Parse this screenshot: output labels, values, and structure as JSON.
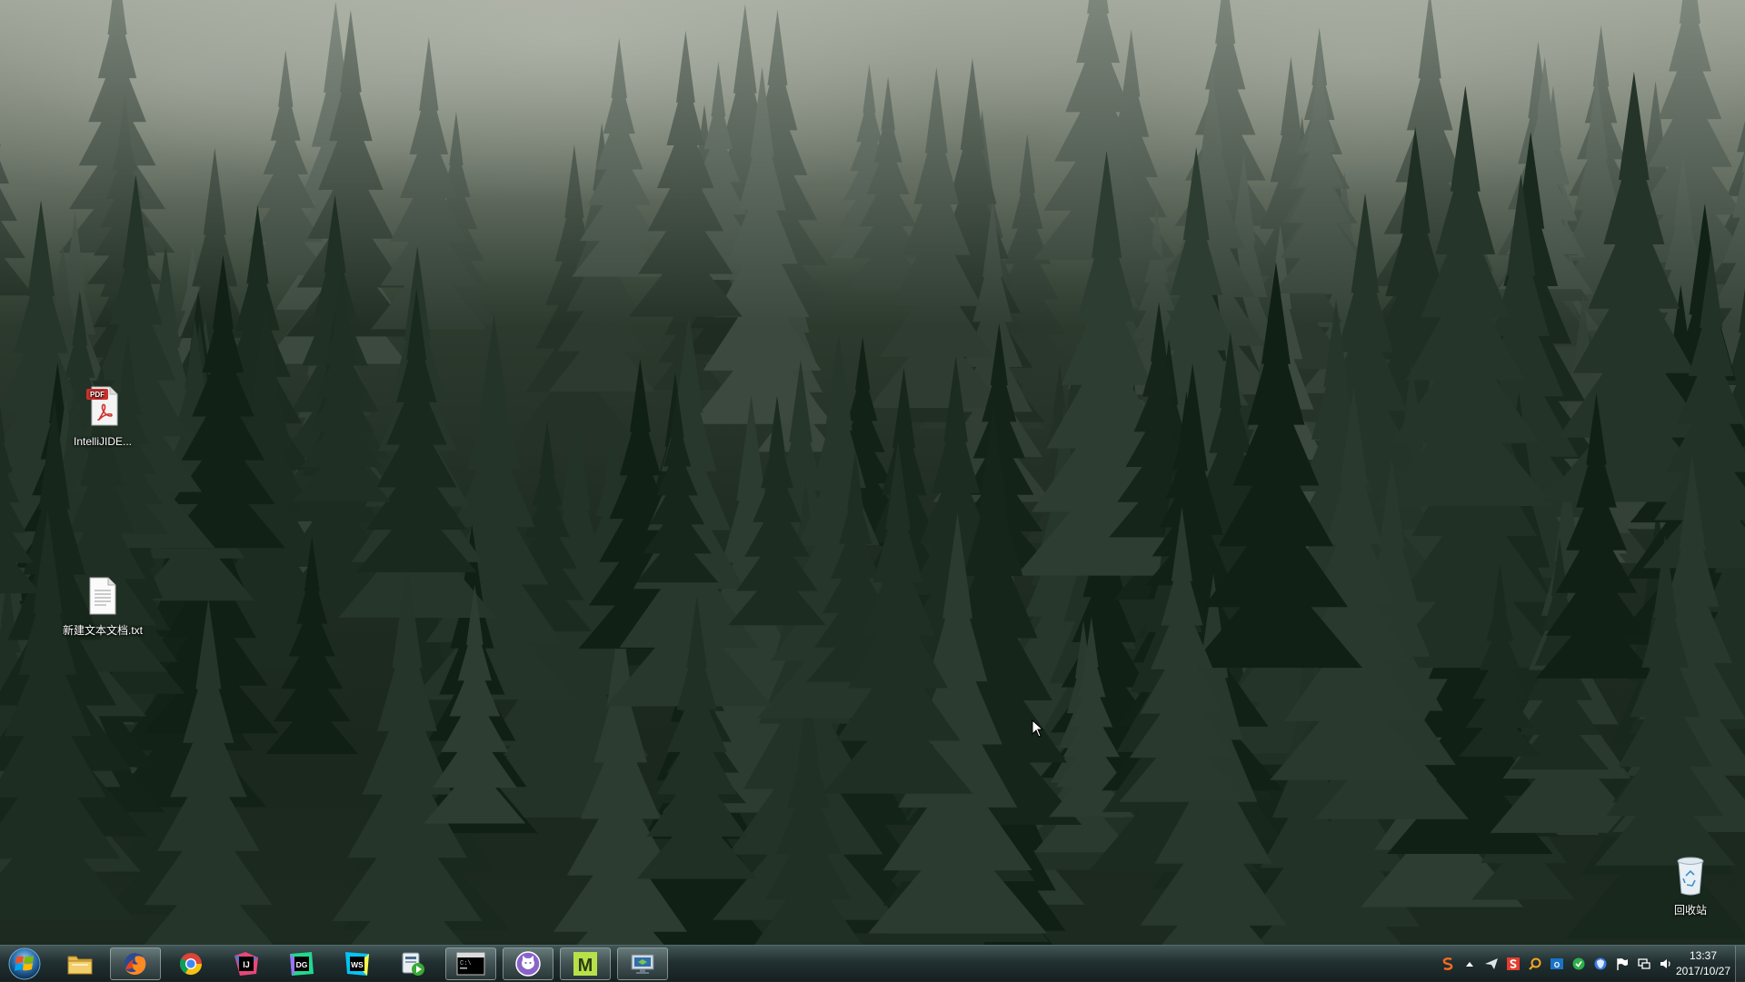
{
  "desktop": {
    "icons": [
      {
        "label": "IntelliJIDE...",
        "type": "pdf",
        "badge": "PDF"
      },
      {
        "label": "新建文本文档.txt",
        "type": "text"
      },
      {
        "label": "回收站",
        "type": "recycle-bin"
      }
    ]
  },
  "taskbar": {
    "start_icon": "windows-orb-icon",
    "pinned": [
      {
        "name": "file-explorer",
        "icon": "folder-icon"
      },
      {
        "name": "firefox",
        "icon": "firefox-icon",
        "active": true
      },
      {
        "name": "chrome",
        "icon": "chrome-icon"
      },
      {
        "name": "intellij-idea",
        "icon": "intellij-icon",
        "text": "IJ"
      },
      {
        "name": "datagrip",
        "icon": "datagrip-icon",
        "text": "DG"
      },
      {
        "name": "webstorm",
        "icon": "webstorm-icon",
        "text": "WS"
      },
      {
        "name": "media-player",
        "icon": "media-player-icon"
      },
      {
        "name": "command-prompt",
        "icon": "terminal-icon",
        "active": true,
        "text": "C:\\"
      },
      {
        "name": "github-desktop",
        "icon": "cat-icon",
        "active": true
      },
      {
        "name": "monitor-app",
        "icon": "m-icon",
        "active": true,
        "text": "M"
      },
      {
        "name": "remote-desktop",
        "icon": "remote-desktop-icon",
        "active": true
      }
    ],
    "tray": {
      "icons": [
        "sogou-ime-icon",
        "show-hidden-icons-icon",
        "send-icon",
        "s-app-icon",
        "search-tray-icon",
        "outlook-icon",
        "green-app-icon",
        "shield-icon",
        "action-center-flag-icon",
        "network-icon",
        "volume-icon"
      ],
      "time": "13:37",
      "date": "2017/10/27"
    }
  },
  "colors": {
    "taskbar": "#22302f",
    "active_highlight": "#c8dcdc",
    "pdf_red": "#d0312d",
    "sky_mist": "#a5a99f",
    "forest_dark": "#1a281e"
  }
}
